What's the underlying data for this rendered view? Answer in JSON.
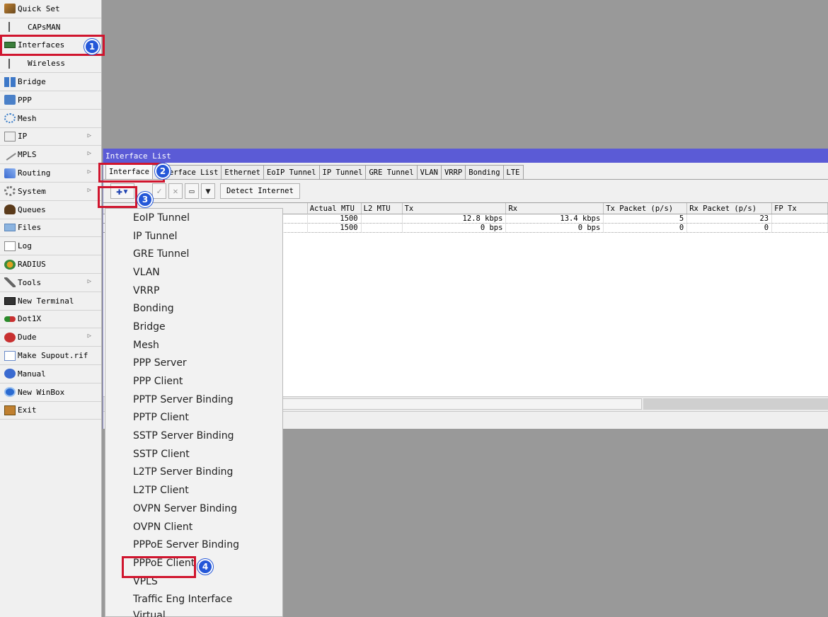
{
  "sidebar": {
    "items": [
      {
        "label": "Quick Set",
        "icon": "wizard-icon",
        "submenu": false
      },
      {
        "label": "CAPsMAN",
        "icon": "antenna-icon",
        "submenu": false
      },
      {
        "label": "Interfaces",
        "icon": "interfaces-icon",
        "submenu": false
      },
      {
        "label": "Wireless",
        "icon": "antenna-icon",
        "submenu": false
      },
      {
        "label": "Bridge",
        "icon": "bridge-icon",
        "submenu": false
      },
      {
        "label": "PPP",
        "icon": "ppp-icon",
        "submenu": false
      },
      {
        "label": "Mesh",
        "icon": "mesh-icon",
        "submenu": false
      },
      {
        "label": "IP",
        "icon": "ip-icon",
        "submenu": true
      },
      {
        "label": "MPLS",
        "icon": "mpls-icon",
        "submenu": true
      },
      {
        "label": "Routing",
        "icon": "routing-icon",
        "submenu": true
      },
      {
        "label": "System",
        "icon": "gear-icon",
        "submenu": true
      },
      {
        "label": "Queues",
        "icon": "queues-icon",
        "submenu": false
      },
      {
        "label": "Files",
        "icon": "folder-icon",
        "submenu": false
      },
      {
        "label": "Log",
        "icon": "log-icon",
        "submenu": false
      },
      {
        "label": "RADIUS",
        "icon": "radius-icon",
        "submenu": false
      },
      {
        "label": "Tools",
        "icon": "tools-icon",
        "submenu": true
      },
      {
        "label": "New Terminal",
        "icon": "terminal-icon",
        "submenu": false
      },
      {
        "label": "Dot1X",
        "icon": "dot1x-icon",
        "submenu": false
      },
      {
        "label": "Dude",
        "icon": "dude-icon",
        "submenu": true
      },
      {
        "label": "Make Supout.rif",
        "icon": "supout-icon",
        "submenu": false
      },
      {
        "label": "Manual",
        "icon": "help-icon",
        "submenu": false
      },
      {
        "label": "New WinBox",
        "icon": "winbox-icon",
        "submenu": false
      },
      {
        "label": "Exit",
        "icon": "exit-icon",
        "submenu": false
      }
    ]
  },
  "window": {
    "title": "Interface List",
    "tabs": [
      "Interface",
      "Interface List",
      "Ethernet",
      "EoIP Tunnel",
      "IP Tunnel",
      "GRE Tunnel",
      "VLAN",
      "VRRP",
      "Bonding",
      "LTE"
    ],
    "toolbar": {
      "add_symbol": "✚▾",
      "enable_symbol": "✓",
      "disable_symbol": "✕",
      "comment_symbol": "▭",
      "filter_symbol": "▼",
      "detect_label": "Detect Internet"
    },
    "table": {
      "columns": [
        "Actual MTU",
        "L2 MTU",
        "Tx",
        "Rx",
        "Tx Packet (p/s)",
        "Rx Packet (p/s)",
        "FP Tx"
      ],
      "rows": [
        {
          "actual_mtu": "1500",
          "l2_mtu": "",
          "tx": "12.8 kbps",
          "rx": "13.4 kbps",
          "tx_packet": "5",
          "rx_packet": "23",
          "fp_tx": ""
        },
        {
          "actual_mtu": "1500",
          "l2_mtu": "",
          "tx": "0 bps",
          "rx": "0 bps",
          "tx_packet": "0",
          "rx_packet": "0",
          "fp_tx": ""
        }
      ]
    }
  },
  "dropdown": {
    "items": [
      "EoIP Tunnel",
      "IP Tunnel",
      "GRE Tunnel",
      "VLAN",
      "VRRP",
      "Bonding",
      "Bridge",
      "Mesh",
      "PPP Server",
      "PPP Client",
      "PPTP Server Binding",
      "PPTP Client",
      "SSTP Server Binding",
      "SSTP Client",
      "L2TP Server Binding",
      "L2TP Client",
      "OVPN Server Binding",
      "OVPN Client",
      "PPPoE Server Binding",
      "PPPoE Client",
      "VPLS",
      "Traffic Eng Interface",
      "Virtual"
    ]
  },
  "annotations": {
    "steps": [
      "1",
      "2",
      "3",
      "4"
    ],
    "highlight_color": "#d0152e",
    "badge_color": "#2457d8"
  },
  "colors": {
    "titlebar": "#5b5bd6",
    "background": "#999999"
  }
}
